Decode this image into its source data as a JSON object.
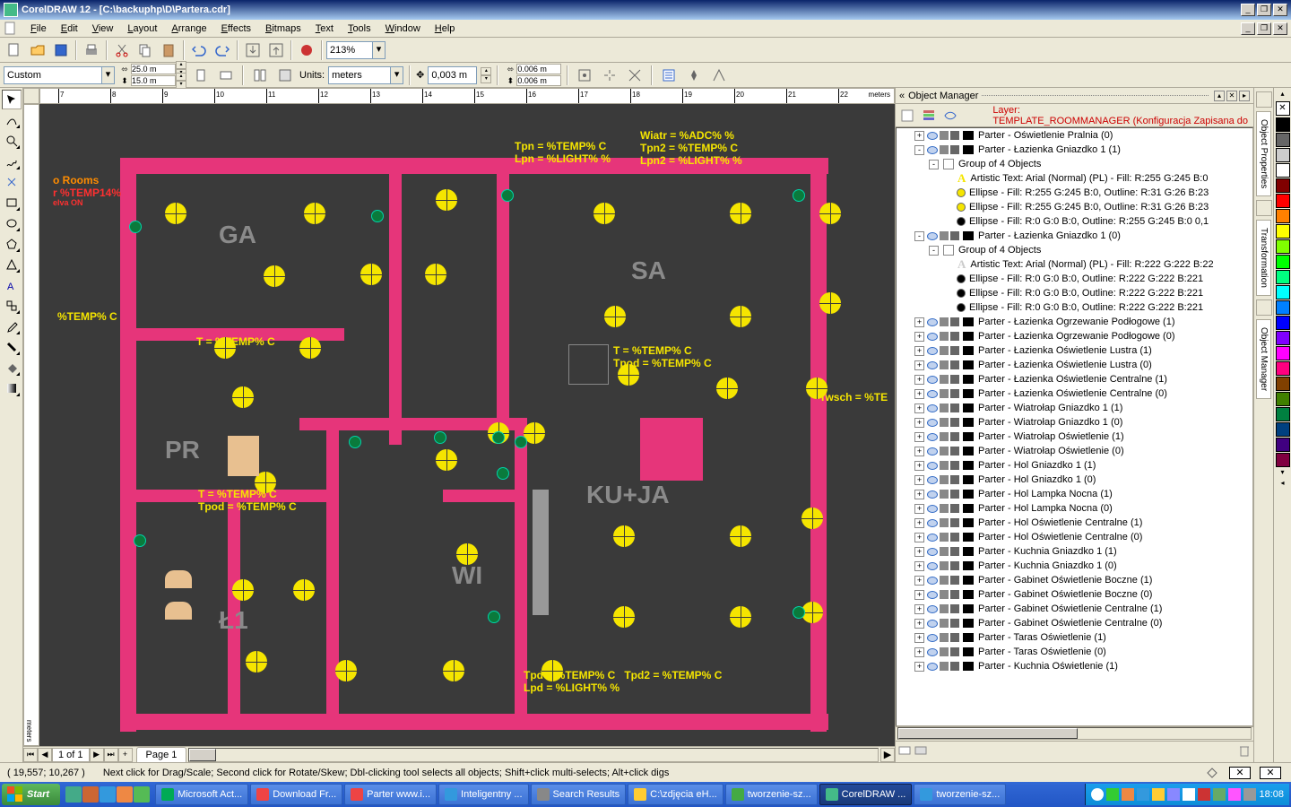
{
  "app": {
    "title": "CorelDRAW 12 - [C:\\backuphp\\D\\Partera.cdr]"
  },
  "menu": [
    "File",
    "Edit",
    "View",
    "Layout",
    "Arrange",
    "Effects",
    "Bitmaps",
    "Text",
    "Tools",
    "Window",
    "Help"
  ],
  "toolbar1": {
    "zoom": "213%"
  },
  "propbar": {
    "preset": "Custom",
    "page_w": "25.0 m",
    "page_h": "15.0 m",
    "units_label": "Units:",
    "units_value": "meters",
    "nudge": "0,003 m",
    "dup_x": "0.006 m",
    "dup_y": "0.006 m"
  },
  "ruler": {
    "ticks": [
      "7",
      "8",
      "9",
      "10",
      "11",
      "12",
      "13",
      "14",
      "15",
      "16",
      "17",
      "18",
      "19",
      "20",
      "21",
      "22"
    ],
    "unit": "meters"
  },
  "canvas": {
    "rooms": {
      "GA": "GA",
      "SA": "SA",
      "PR": "PR",
      "WI": "WI",
      "L1": "Ł1",
      "KUJA": "KU+JA"
    },
    "labels": {
      "rooms_hdr": "o Rooms",
      "temp14": "r %TEMP14%",
      "elva": "elva ON",
      "tempC": "%TEMP% C",
      "t_temp": "T = %TEMP% C",
      "t_tpod": "T = %TEMP% C\nTpod = %TEMP% C",
      "sa_t": "T = %TEMP% C\nTpod = %TEMP% C",
      "twsch": "Twsch = %TE",
      "top1": "Tpn = %TEMP% C\nLpn = %LIGHT% %",
      "top2": "Wiatr = %ADC% %\nTpn2 = %TEMP% C\nLpn2 = %LIGHT% %",
      "bottom": "Tpd = %TEMP% C   Tpd2 = %TEMP% C\nLpd = %LIGHT% %"
    }
  },
  "pagenav": {
    "info": "1 of 1",
    "tab": "Page 1"
  },
  "panel": {
    "title": "Object Manager",
    "layer_label": "Layer:",
    "layer_value": "TEMPLATE_ROOMMANAGER (Konfiguracja Zapisana do",
    "tree": [
      {
        "d": 1,
        "exp": "+",
        "eye": 1,
        "txt": "Parter - Oświetlenie Pralnia (0)",
        "sw": "#000"
      },
      {
        "d": 1,
        "exp": "-",
        "eye": 1,
        "txt": "Parter - Łazienka Gniazdko 1 (1)",
        "sw": "#000"
      },
      {
        "d": 2,
        "exp": "-",
        "grp": 1,
        "txt": "Group of 4 Objects"
      },
      {
        "d": 3,
        "art": "A",
        "ac": "#f5e500",
        "txt": "Artistic Text: Arial (Normal) (PL) - Fill: R:255 G:245 B:0"
      },
      {
        "d": 3,
        "ell": "#f5e500",
        "txt": "Ellipse - Fill: R:255 G:245 B:0, Outline: R:31 G:26 B:23"
      },
      {
        "d": 3,
        "ell": "#f5e500",
        "txt": "Ellipse - Fill: R:255 G:245 B:0, Outline: R:31 G:26 B:23"
      },
      {
        "d": 3,
        "ell": "#000",
        "txt": "Ellipse - Fill: R:0 G:0 B:0, Outline: R:255 G:245 B:0  0,1"
      },
      {
        "d": 1,
        "exp": "-",
        "eye": 1,
        "txt": "Parter - Łazienka Gniazdko 1 (0)",
        "sw": "#000"
      },
      {
        "d": 2,
        "exp": "-",
        "grp": 1,
        "txt": "Group of 4 Objects"
      },
      {
        "d": 3,
        "art": "A",
        "ac": "#ccc",
        "txt": "Artistic Text: Arial (Normal) (PL) - Fill: R:222 G:222 B:22"
      },
      {
        "d": 3,
        "ell": "#000",
        "txt": "Ellipse - Fill: R:0 G:0 B:0, Outline: R:222 G:222 B:221"
      },
      {
        "d": 3,
        "ell": "#000",
        "txt": "Ellipse - Fill: R:0 G:0 B:0, Outline: R:222 G:222 B:221"
      },
      {
        "d": 3,
        "ell": "#000",
        "txt": "Ellipse - Fill: R:0 G:0 B:0, Outline: R:222 G:222 B:221"
      },
      {
        "d": 1,
        "exp": "+",
        "eye": 1,
        "txt": "Parter - Łazienka Ogrzewanie Podłogowe (1)",
        "sw": "#000"
      },
      {
        "d": 1,
        "exp": "+",
        "eye": 1,
        "txt": "Parter - Łazienka Ogrzewanie Podłogowe (0)",
        "sw": "#000"
      },
      {
        "d": 1,
        "exp": "+",
        "eye": 1,
        "txt": "Parter - Łazienka Oświetlenie Lustra (1)",
        "sw": "#000"
      },
      {
        "d": 1,
        "exp": "+",
        "eye": 1,
        "txt": "Parter - Łazienka Oświetlenie Lustra (0)",
        "sw": "#000"
      },
      {
        "d": 1,
        "exp": "+",
        "eye": 1,
        "txt": "Parter - Łazienka Oświetlenie Centralne (1)",
        "sw": "#000"
      },
      {
        "d": 1,
        "exp": "+",
        "eye": 1,
        "txt": "Parter - Łazienka Oświetlenie Centralne (0)",
        "sw": "#000"
      },
      {
        "d": 1,
        "exp": "+",
        "eye": 1,
        "txt": "Parter - Wiatrołap Gniazdko 1 (1)",
        "sw": "#000"
      },
      {
        "d": 1,
        "exp": "+",
        "eye": 1,
        "txt": "Parter - Wiatrołap Gniazdko 1 (0)",
        "sw": "#000"
      },
      {
        "d": 1,
        "exp": "+",
        "eye": 1,
        "txt": "Parter - Wiatrołap Oświetlenie (1)",
        "sw": "#000"
      },
      {
        "d": 1,
        "exp": "+",
        "eye": 1,
        "txt": "Parter - Wiatrołap Oświetlenie (0)",
        "sw": "#000"
      },
      {
        "d": 1,
        "exp": "+",
        "eye": 1,
        "txt": "Parter - Hol Gniazdko 1 (1)",
        "sw": "#000"
      },
      {
        "d": 1,
        "exp": "+",
        "eye": 1,
        "txt": "Parter - Hol Gniazdko 1 (0)",
        "sw": "#000"
      },
      {
        "d": 1,
        "exp": "+",
        "eye": 1,
        "txt": "Parter - Hol Lampka Nocna (1)",
        "sw": "#000"
      },
      {
        "d": 1,
        "exp": "+",
        "eye": 1,
        "txt": "Parter - Hol Lampka Nocna (0)",
        "sw": "#000"
      },
      {
        "d": 1,
        "exp": "+",
        "eye": 1,
        "txt": "Parter - Hol Oświetlenie Centralne (1)",
        "sw": "#000"
      },
      {
        "d": 1,
        "exp": "+",
        "eye": 1,
        "txt": "Parter - Hol Oświetlenie Centralne (0)",
        "sw": "#000"
      },
      {
        "d": 1,
        "exp": "+",
        "eye": 1,
        "txt": "Parter - Kuchnia Gniazdko 1 (1)",
        "sw": "#000"
      },
      {
        "d": 1,
        "exp": "+",
        "eye": 1,
        "txt": "Parter - Kuchnia Gniazdko 1 (0)",
        "sw": "#000"
      },
      {
        "d": 1,
        "exp": "+",
        "eye": 1,
        "txt": "Parter - Gabinet Oświetlenie Boczne (1)",
        "sw": "#000"
      },
      {
        "d": 1,
        "exp": "+",
        "eye": 1,
        "txt": "Parter - Gabinet Oświetlenie Boczne (0)",
        "sw": "#000"
      },
      {
        "d": 1,
        "exp": "+",
        "eye": 1,
        "txt": "Parter - Gabinet Oświetlenie Centralne (1)",
        "sw": "#000"
      },
      {
        "d": 1,
        "exp": "+",
        "eye": 1,
        "txt": "Parter - Gabinet Oświetlenie Centralne (0)",
        "sw": "#000"
      },
      {
        "d": 1,
        "exp": "+",
        "eye": 1,
        "txt": "Parter - Taras Oświetlenie (1)",
        "sw": "#000"
      },
      {
        "d": 1,
        "exp": "+",
        "eye": 1,
        "txt": "Parter - Taras Oświetlenie (0)",
        "sw": "#000"
      },
      {
        "d": 1,
        "exp": "+",
        "eye": 1,
        "txt": "Parter - Kuchnia Oświetlenie (1)",
        "sw": "#000"
      }
    ]
  },
  "dock_tabs": [
    "Object Properties",
    "Transformation",
    "Object Manager"
  ],
  "palette": [
    "#000",
    "#666",
    "#ccc",
    "#fff",
    "#800000",
    "#f00",
    "#ff8000",
    "#ff0",
    "#80ff00",
    "#0f0",
    "#00ff80",
    "#0ff",
    "#0080ff",
    "#00f",
    "#8000ff",
    "#f0f",
    "#ff0080",
    "#804000",
    "#408000",
    "#008040",
    "#004080",
    "#400080",
    "#800040"
  ],
  "status": {
    "coords": "( 19,557; 10,267 )",
    "hint": "Next click for Drag/Scale; Second click for Rotate/Skew; Dbl-clicking tool selects all objects; Shift+click multi-selects; Alt+click digs"
  },
  "taskbar": {
    "start": "Start",
    "tasks": [
      {
        "t": "Microsoft Act...",
        "ico": "#0a5"
      },
      {
        "t": "Download Fr...",
        "ico": "#e44"
      },
      {
        "t": "Parter www.i...",
        "ico": "#e44"
      },
      {
        "t": "Inteligentny ...",
        "ico": "#39d"
      },
      {
        "t": "Search Results",
        "ico": "#888"
      },
      {
        "t": "C:\\zdjęcia eH...",
        "ico": "#fc3"
      },
      {
        "t": "tworzenie-sz...",
        "ico": "#4a4"
      },
      {
        "t": "CorelDRAW ...",
        "ico": "#4b8",
        "active": true
      },
      {
        "t": "tworzenie-sz...",
        "ico": "#39d"
      }
    ],
    "clock": "18:08"
  }
}
